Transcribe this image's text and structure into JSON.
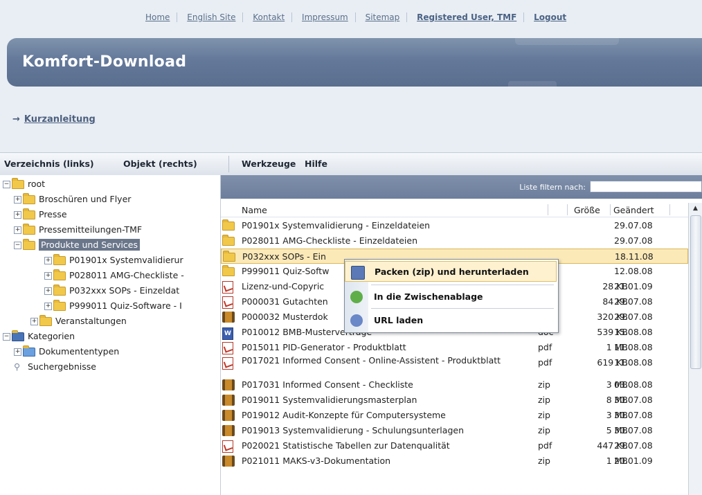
{
  "topnav": {
    "home": "Home",
    "english": "English Site",
    "kontakt": "Kontakt",
    "impressum": "Impressum",
    "sitemap": "Sitemap",
    "user": "Registered User, TMF",
    "logout": "Logout"
  },
  "banner": {
    "title": "Komfort-Download"
  },
  "quick": {
    "arrow": "→",
    "link": "Kurzanleitung"
  },
  "menubar": {
    "verzeichnis": "Verzeichnis (links)",
    "objekt": "Objekt (rechts)",
    "werkzeuge": "Werkzeuge",
    "hilfe": "Hilfe"
  },
  "tree": {
    "root": "root",
    "broschueren": "Broschüren und Flyer",
    "presse": "Presse",
    "pressemitteilungen": "Pressemitteilungen-TMF",
    "produkte": "Produkte und Services",
    "p01901x": "P01901x Systemvalidierur",
    "p028011": "P028011 AMG-Checkliste -",
    "p032xxx": "P032xxx SOPs - Einzeldat",
    "p999011": "P999011 Quiz-Software - I",
    "veranstaltungen": "Veranstaltungen",
    "kategorien": "Kategorien",
    "dokumententypen": "Dokumententypen",
    "suchergebnisse": "Suchergebnisse"
  },
  "list": {
    "filter_label": "Liste filtern nach:",
    "filter_value": "",
    "headers": {
      "name": "Name",
      "size": "Größe",
      "changed": "Geändert"
    },
    "rows": [
      {
        "icon": "folder",
        "name": "P01901x Systemvalidierung - Einzeldateien",
        "type": "",
        "size": "",
        "date": "29.07.08"
      },
      {
        "icon": "folder",
        "name": "P028011 AMG-Checkliste - Einzeldateien",
        "type": "",
        "size": "",
        "date": "29.07.08"
      },
      {
        "icon": "folder",
        "name": "P032xxx SOPs - Ein",
        "type": "",
        "size": "",
        "date": "18.11.08"
      },
      {
        "icon": "folder",
        "name": "P999011 Quiz-Softw",
        "type": "",
        "size": "",
        "date": "12.08.08"
      },
      {
        "icon": "pdf",
        "name": "Lizenz-und-Copyric",
        "type": "",
        "size": "28 KB",
        "date": "21.01.09"
      },
      {
        "icon": "pdf",
        "name": "P000031 Gutachten",
        "type": "",
        "size": "84 KB",
        "date": "29.07.08"
      },
      {
        "icon": "zip",
        "name": "P000032 Musterdok",
        "type": "",
        "size": "320 KB",
        "date": "29.07.08"
      },
      {
        "icon": "doc",
        "name": "P010012 BMB-Musterverträge",
        "type": "doc",
        "size": "539 KB",
        "date": "15.08.08"
      },
      {
        "icon": "pdf",
        "name": "P015011 PID-Generator - Produktblatt",
        "type": "pdf",
        "size": "1 MB",
        "date": "11.08.08"
      },
      {
        "icon": "pdf",
        "name": "P017021 Informed Consent - Online-Assistent - Produktblatt",
        "type": "pdf",
        "size": "619 KB",
        "date": "11.08.08"
      },
      {
        "icon": "zip",
        "name": "P017031 Informed Consent - Checkliste",
        "type": "zip",
        "size": "3 MB",
        "date": "03.08.08"
      },
      {
        "icon": "zip",
        "name": "P019011 Systemvalidierungsmasterplan",
        "type": "zip",
        "size": "8 MB",
        "date": "30.07.08"
      },
      {
        "icon": "zip",
        "name": "P019012 Audit-Konzepte für Computersysteme",
        "type": "zip",
        "size": "3 MB",
        "date": "30.07.08"
      },
      {
        "icon": "zip",
        "name": "P019013 Systemvalidierung - Schulungsunterlagen",
        "type": "zip",
        "size": "5 MB",
        "date": "30.07.08"
      },
      {
        "icon": "pdf",
        "name": "P020021 Statistische Tabellen zur Datenqualität",
        "type": "pdf",
        "size": "447 KB",
        "date": "29.07.08"
      },
      {
        "icon": "zip",
        "name": "P021011 MAKS-v3-Dokumentation",
        "type": "zip",
        "size": "1 MB",
        "date": "20.01.09"
      }
    ]
  },
  "context_menu": {
    "pack": "Packen (zip) und herunterladen",
    "clipboard": "In die Zwischenablage",
    "url": "URL laden"
  }
}
